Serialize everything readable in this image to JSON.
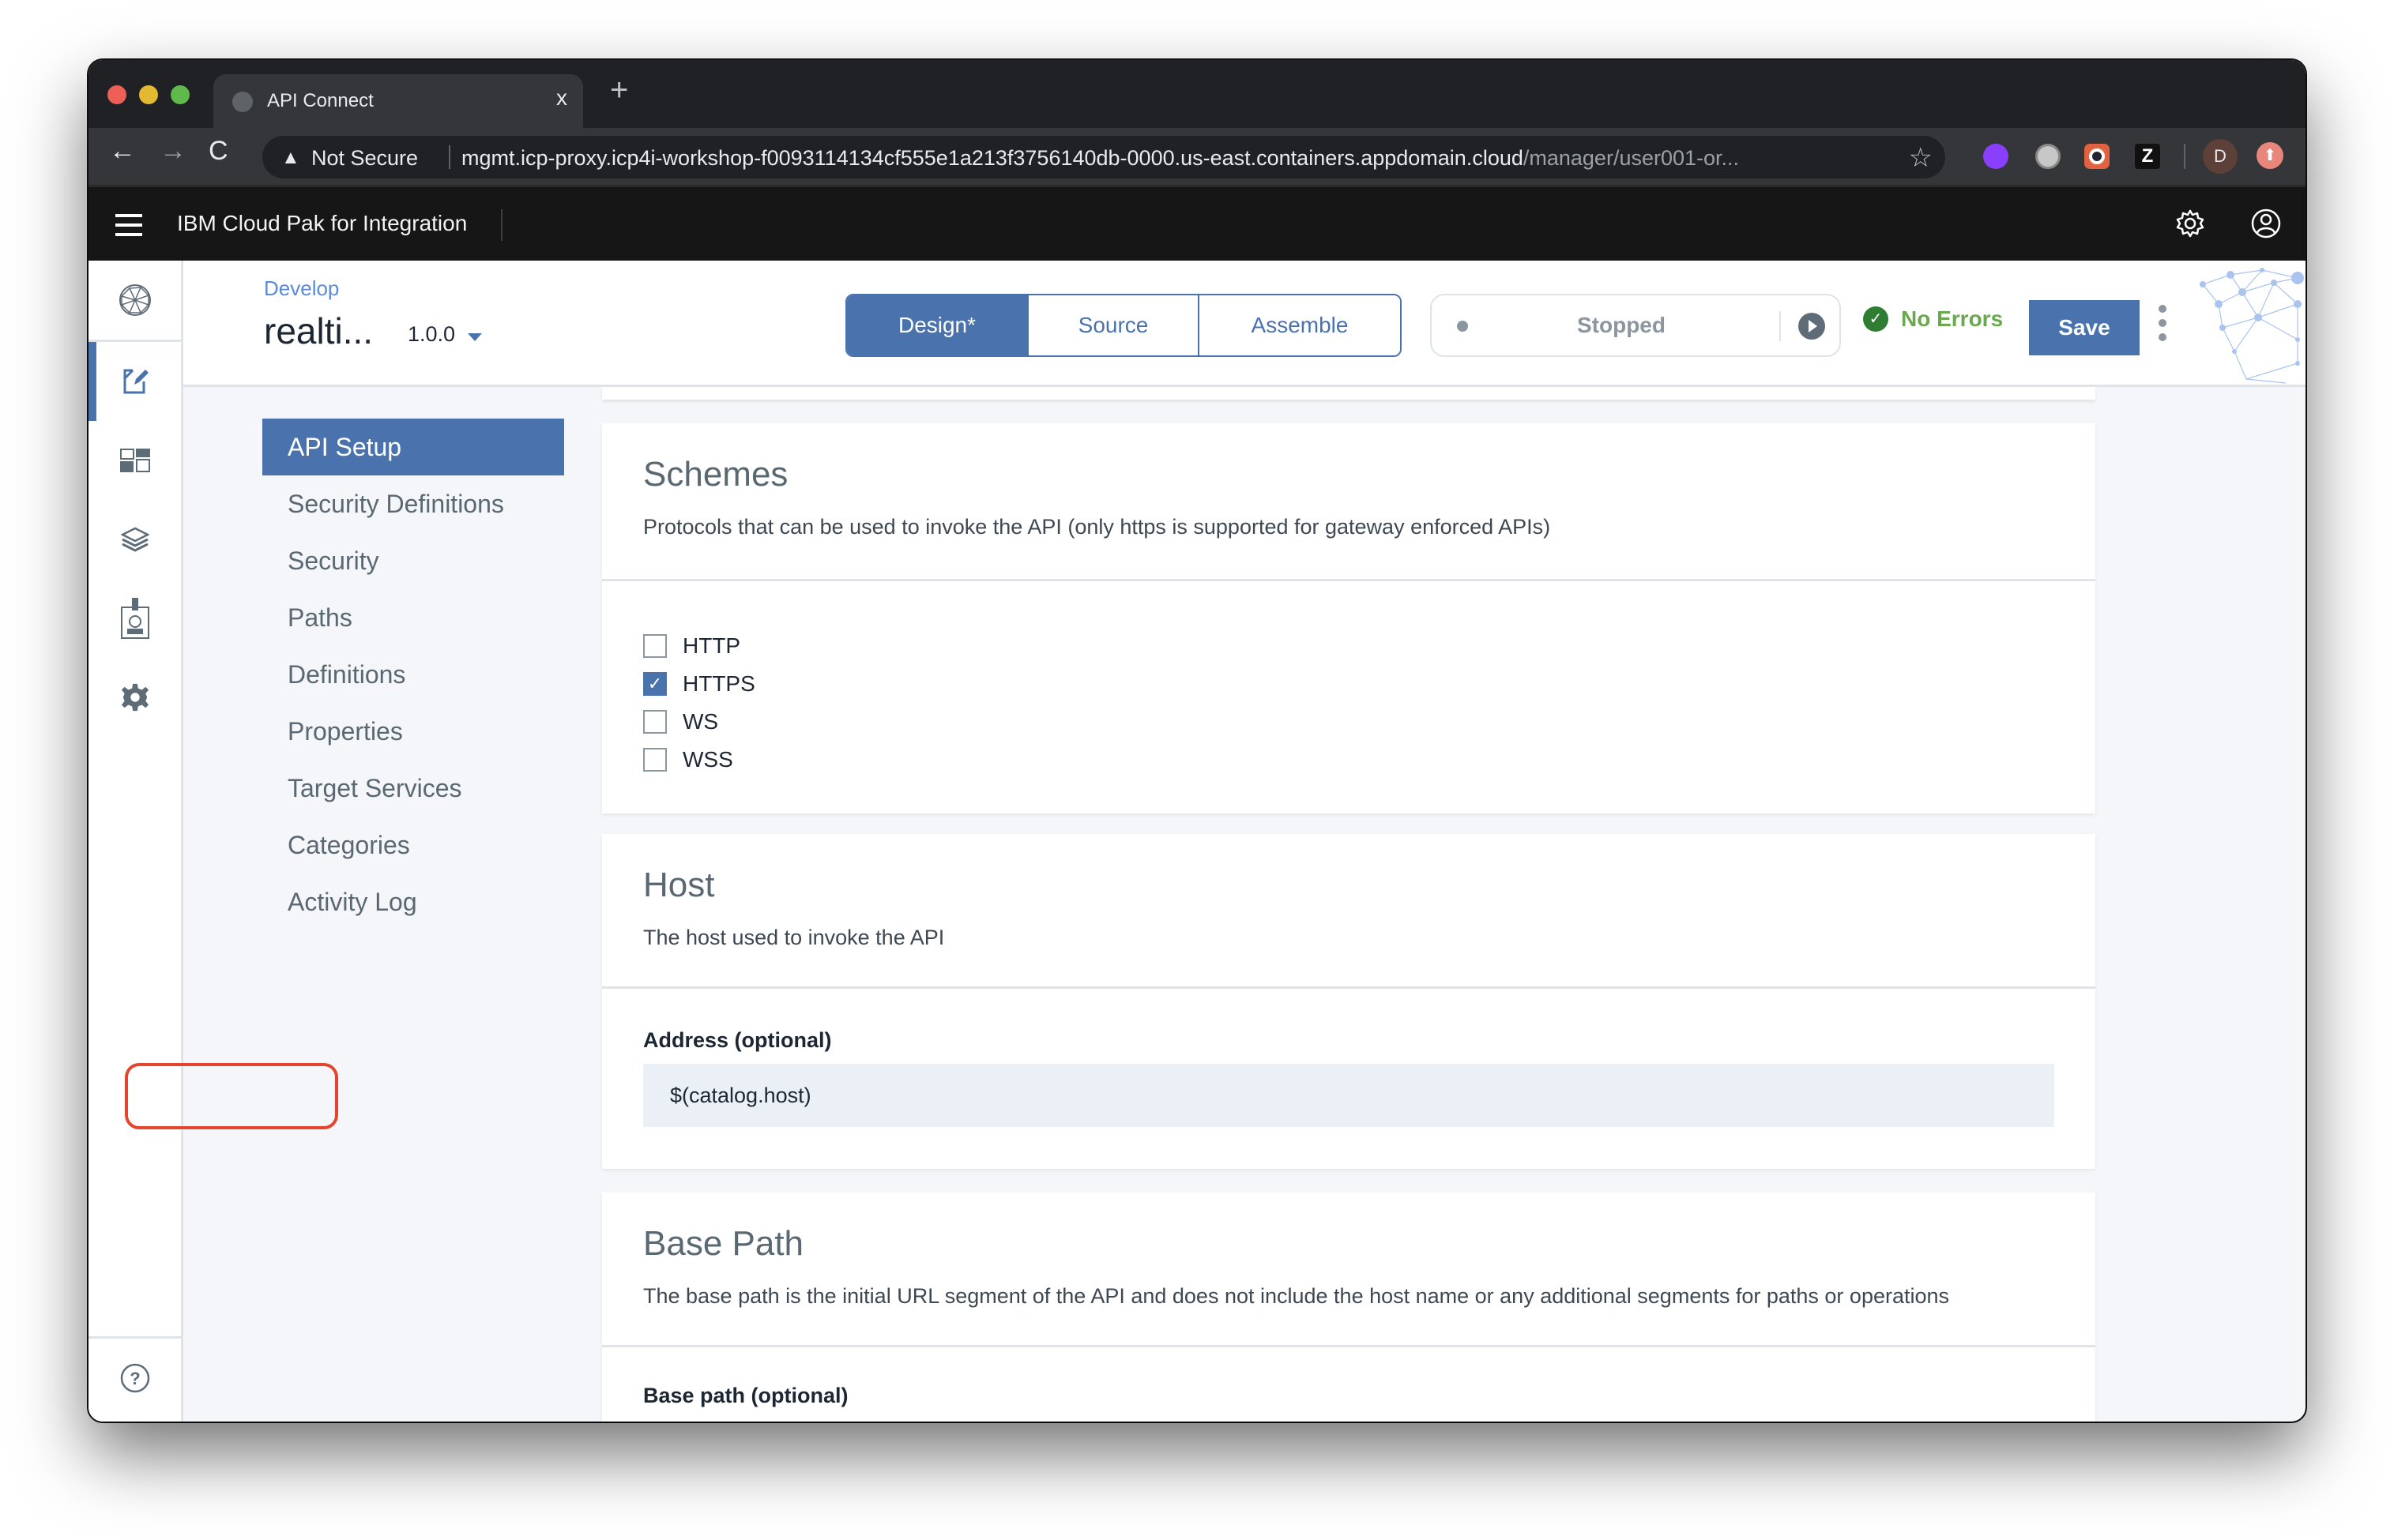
{
  "browser": {
    "tab_title": "API Connect",
    "tab_close": "x",
    "new_tab": "+",
    "back": "←",
    "forward": "→",
    "reload": "C",
    "security_label": "Not Secure",
    "url_host": "mgmt.icp-proxy.icp4i-workshop-f0093114134cf555e1a213f3756140db-0000.us-east.containers.appdomain.cloud",
    "url_path": "/manager/user001-or...",
    "bookmark_icon": "☆",
    "extensions": [
      "purple-chat-extension",
      "grey-orb-extension",
      "camera-extension",
      "z-extension"
    ],
    "ext_z_label": "Z",
    "profile_initial": "D",
    "update_icon": "⬆"
  },
  "ibm_header": {
    "product_name": "IBM Cloud Pak for Integration"
  },
  "app_header": {
    "breadcrumb": "Develop",
    "api_title": "realti...",
    "version": "1.0.0",
    "view_tabs": [
      {
        "label": "Design*",
        "active": true
      },
      {
        "label": "Source",
        "active": false
      },
      {
        "label": "Assemble",
        "active": false
      }
    ],
    "runtime_status": "Stopped",
    "validation_status": "No Errors",
    "save_label": "Save"
  },
  "rail": {
    "items": [
      "network-logo",
      "develop",
      "dashboard",
      "layers",
      "members",
      "settings"
    ],
    "active": "develop",
    "help": "help"
  },
  "left_nav": {
    "items": [
      {
        "label": "API Setup",
        "active": true
      },
      {
        "label": "Security Definitions",
        "active": false
      },
      {
        "label": "Security",
        "active": false
      },
      {
        "label": "Paths",
        "active": false
      },
      {
        "label": "Definitions",
        "active": false
      },
      {
        "label": "Properties",
        "active": false
      },
      {
        "label": "Target Services",
        "active": false
      },
      {
        "label": "Categories",
        "active": false
      },
      {
        "label": "Activity Log",
        "active": false
      }
    ]
  },
  "schemes": {
    "title": "Schemes",
    "description": "Protocols that can be used to invoke the API (only https is supported for gateway enforced APIs)",
    "options": [
      {
        "label": "HTTP",
        "checked": false
      },
      {
        "label": "HTTPS",
        "checked": true
      },
      {
        "label": "WS",
        "checked": false
      },
      {
        "label": "WSS",
        "checked": false
      }
    ]
  },
  "host": {
    "title": "Host",
    "description": "The host used to invoke the API",
    "address_label": "Address (optional)",
    "address_value": "$(catalog.host)"
  },
  "base_path": {
    "title": "Base Path",
    "description": "The base path is the initial URL segment of the API and does not include the host name or any additional segments for paths or operations",
    "field_label": "Base path (optional)"
  },
  "colors": {
    "accent": "#4a73ae",
    "success": "#2e7d32",
    "success_text": "#6aa84f",
    "highlight_ring": "#e5452f",
    "header_bg": "#161616"
  }
}
